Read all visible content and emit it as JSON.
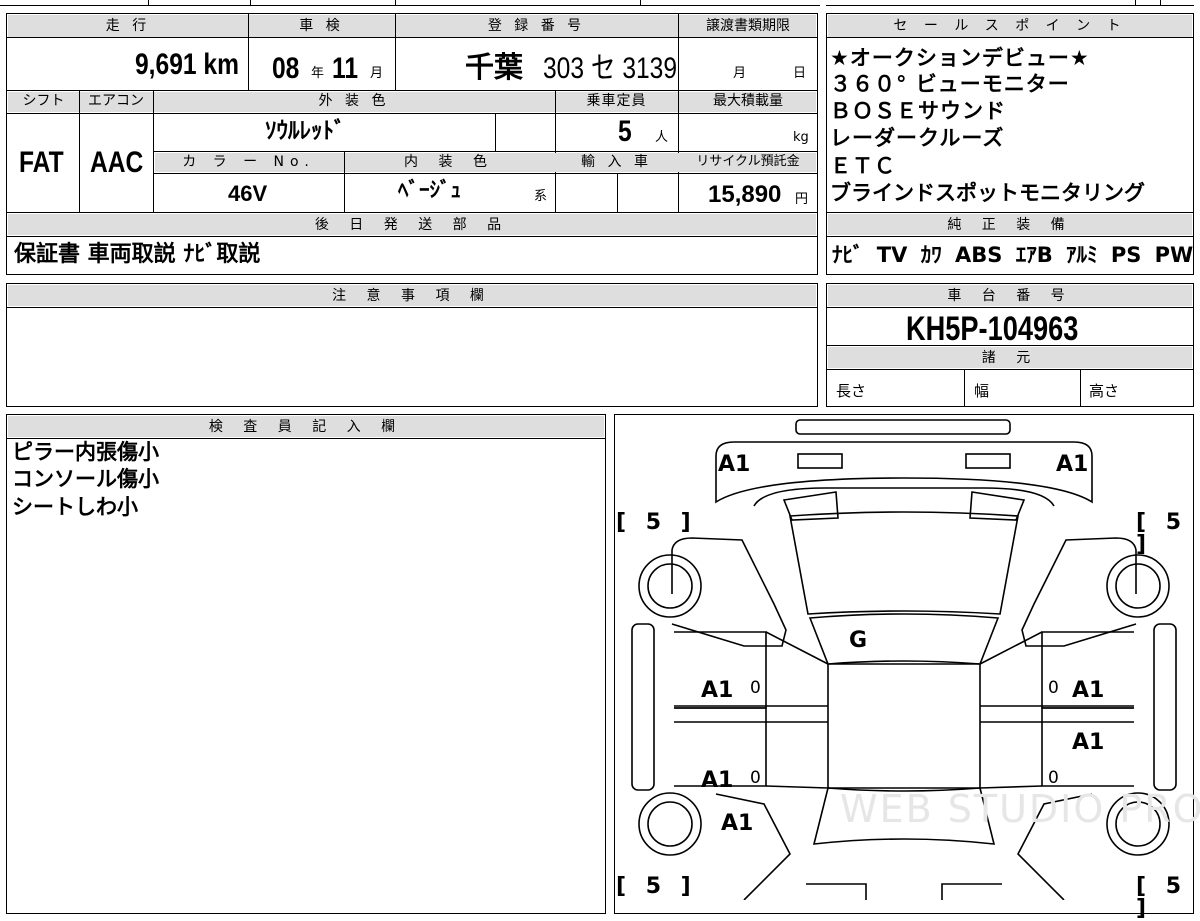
{
  "sheet": {
    "headers": {
      "mileage": "走 行",
      "inspection": "車 検",
      "reg_no": "登 録 番 号",
      "transfer": "譲渡書類期限",
      "shift": "シフト",
      "aircon": "エアコン",
      "ext_color": "外 装 色",
      "capacity": "乗車定員",
      "max_load": "最大積載量",
      "color_no": "カ ラ ー No.",
      "int_color": "内 装 色",
      "import": "輸 入 車",
      "recycle": "リサイクル預託金",
      "later_parts": "後 日 発 送 部 品",
      "notes": "注 意 事 項 欄",
      "sales_points": "セ ー ル ス ポ イ ン ト",
      "equipment": "純 正 装 備",
      "chassis": "車 台 番 号",
      "specs": "諸 元",
      "inspector": "検 査 員 記 入 欄"
    },
    "values": {
      "mileage": "9,691 km",
      "insp_year": "08",
      "insp_year_unit": "年",
      "insp_month": "11",
      "insp_month_unit": "月",
      "reg_area": "千葉",
      "reg_num": "303 セ 3139",
      "transfer_month": "月",
      "transfer_day": "日",
      "shift": "FAT",
      "aircon": "AAC",
      "ext_color": "ｿｳﾙﾚｯﾄﾞ",
      "capacity": "5",
      "capacity_unit": "人",
      "load_unit": "kg",
      "color_no": "46V",
      "int_color": "ﾍﾞｰｼﾞｭ",
      "int_suffix": "系",
      "recycle": "15,890",
      "recycle_unit": "円",
      "later_parts": "保証書 車両取説 ﾅﾋﾞ取説",
      "equipment": "ﾅﾋﾞ TV ｶﾜ ABS ｴｱB ｱﾙﾐ PS PW",
      "chassis": "KH5P-104963",
      "spec_length": "長さ",
      "spec_width": "幅",
      "spec_height": "高さ"
    },
    "sales_points": [
      "★オークションデビュー★",
      "３６０° ビューモニター",
      "ＢＯＳＥサウンド",
      "レーダークルーズ",
      "ＥＴＣ",
      "ブラインドスポットモニタリング"
    ],
    "inspector_notes": [
      "ピラー内張傷小",
      "コンソール傷小",
      "シートしわ小"
    ],
    "diagram": {
      "front_left_corner": "A1",
      "front_right_corner": "A1",
      "tread_fl": "[ 5 ]",
      "tread_fr": "[ 5 ]",
      "tread_rl": "[ 5 ]",
      "tread_rr": "[ 5 ]",
      "windshield": "G",
      "front_left_door": "A1",
      "front_right_door": "A1",
      "rear_right_door": "A1",
      "rear_left_door": "A1",
      "rear_left_quarter": "A1",
      "zero_mark": "0"
    }
  }
}
